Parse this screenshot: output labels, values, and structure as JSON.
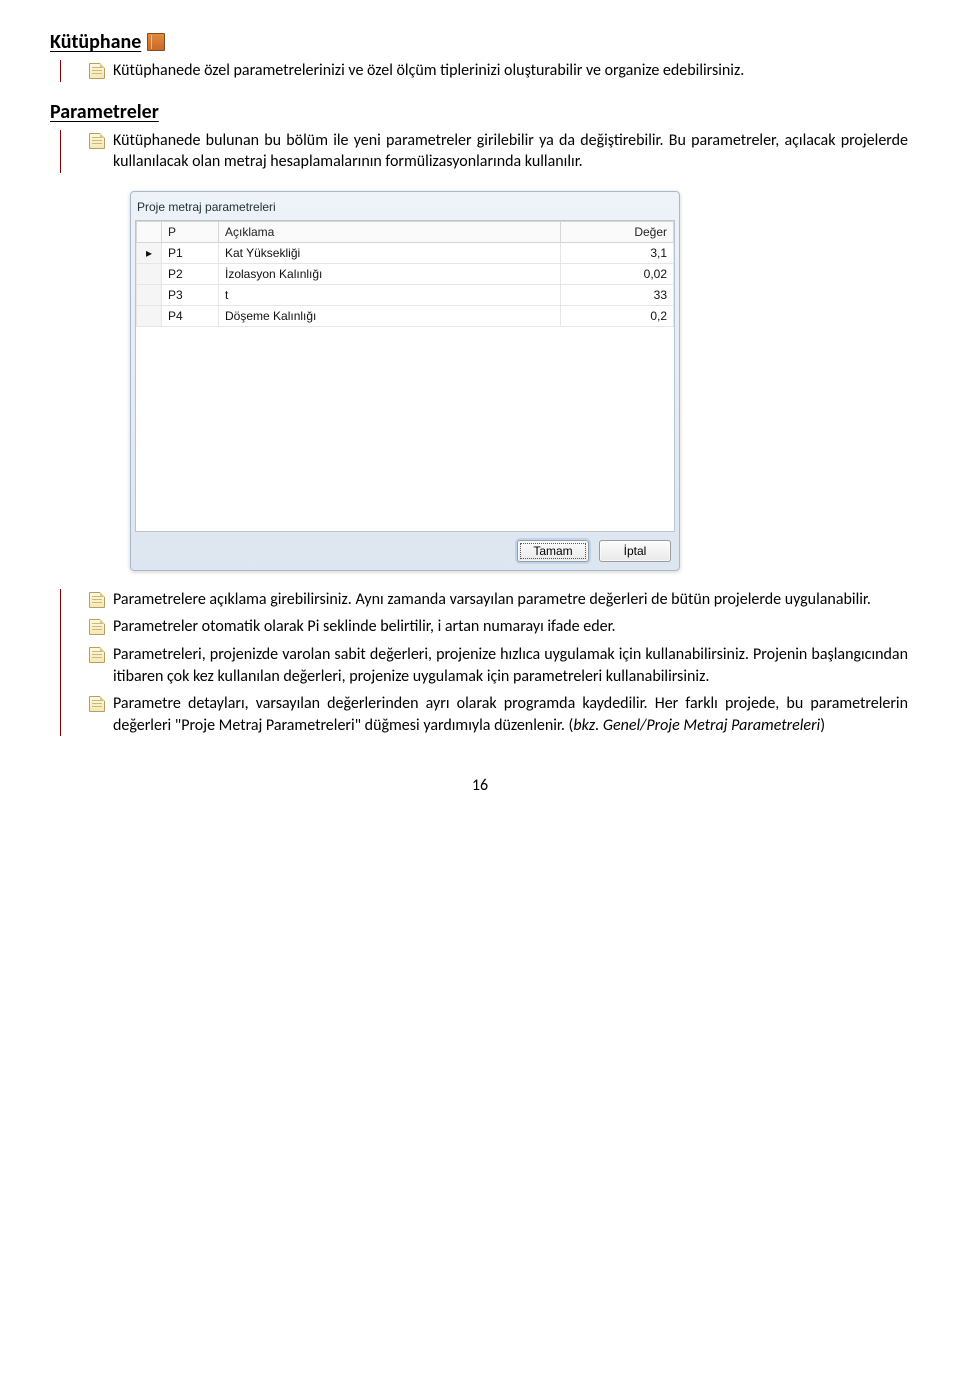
{
  "section1": {
    "heading": "Kütüphane",
    "items": [
      "Kütüphanede özel parametrelerinizi ve özel ölçüm tiplerinizi oluşturabilir ve organize edebilirsiniz."
    ]
  },
  "section2": {
    "heading": "Parametreler",
    "intro": [
      "Kütüphanede bulunan bu bölüm ile yeni parametreler girilebilir ya da değiştirebilir. Bu parametreler, açılacak projelerde kullanılacak olan metraj hesaplamalarının formülizasyonlarında kullanılır."
    ],
    "tail_blocks": [
      {
        "text": "Parametrelere açıklama girebilirsiniz. Aynı zamanda varsayılan parametre değerleri de bütün projelerde uygulanabilir."
      },
      {
        "text": "Parametreler otomatik olarak Pi seklinde belirtilir, i artan numarayı ifade eder."
      },
      {
        "text": "Parametreleri, projenizde varolan sabit değerleri, projenize hızlıca uygulamak için kullanabilirsiniz. Projenin başlangıcından itibaren çok kez kullanılan değerleri, projenize uygulamak için parametreleri kullanabilirsiniz."
      },
      {
        "text": "Parametre detayları, varsayılan değerlerinden ayrı olarak programda kaydedilir. Her farklı projede, bu parametrelerin değerleri \"Proje Metraj Parametreleri\" düğmesi yardımıyla düzenlenir. (",
        "italic": "bkz. Genel/Proje Metraj Parametreleri",
        "after": ")"
      }
    ]
  },
  "dialog": {
    "title": "Proje metraj parametreleri",
    "columns": {
      "p": "P",
      "desc": "Açıklama",
      "val": "Değer"
    },
    "rows": [
      {
        "p": "P1",
        "desc": "Kat Yüksekliği",
        "val": "3,1",
        "current": true
      },
      {
        "p": "P2",
        "desc": "İzolasyon Kalınlığı",
        "val": "0,02"
      },
      {
        "p": "P3",
        "desc": "t",
        "val": "33"
      },
      {
        "p": "P4",
        "desc": "Döşeme Kalınlığı",
        "val": "0,2"
      }
    ],
    "ok": "Tamam",
    "cancel": "İptal"
  },
  "page_number": "16"
}
